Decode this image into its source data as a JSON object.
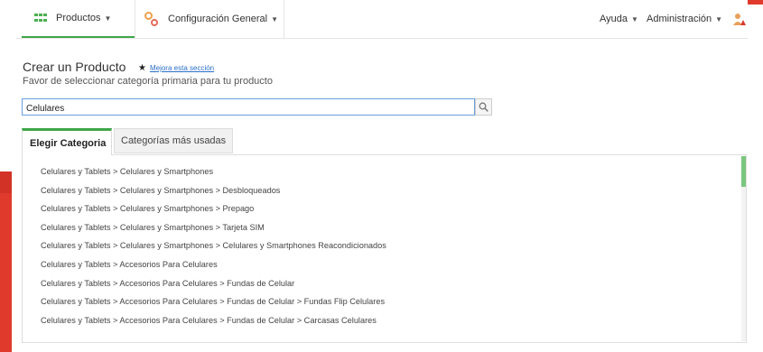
{
  "nav": {
    "productos": "Productos",
    "configuracion": "Configuración General",
    "ayuda": "Ayuda",
    "administracion": "Administración",
    "accent_color": "#3fa648"
  },
  "header": {
    "title": "Crear un Producto",
    "improve_link": "Mejora esta sección",
    "subtitle": "Favor de seleccionar categoría primaria para tu producto"
  },
  "search": {
    "value": "Celulares"
  },
  "tabs": [
    {
      "label": "Elegir Categoria",
      "active": true
    },
    {
      "label": "Categorías más usadas",
      "active": false
    }
  ],
  "categories": [
    "Celulares y Tablets > Celulares y Smartphones",
    "Celulares y Tablets > Celulares y Smartphones > Desbloqueados",
    "Celulares y Tablets > Celulares y Smartphones > Prepago",
    "Celulares y Tablets > Celulares y Smartphones > Tarjeta SIM",
    "Celulares y Tablets > Celulares y Smartphones > Celulares y Smartphones Reacondicionados",
    "Celulares y Tablets > Accesorios Para Celulares",
    "Celulares y Tablets > Accesorios Para Celulares > Fundas de Celular",
    "Celulares y Tablets > Accesorios Para Celulares > Fundas de Celular > Fundas Flip Celulares",
    "Celulares y Tablets > Accesorios Para Celulares > Fundas de Celular > Carcasas Celulares"
  ],
  "icons": [
    "grid-icon",
    "gear-icon",
    "user-icon",
    "star-icon",
    "search-icon"
  ]
}
